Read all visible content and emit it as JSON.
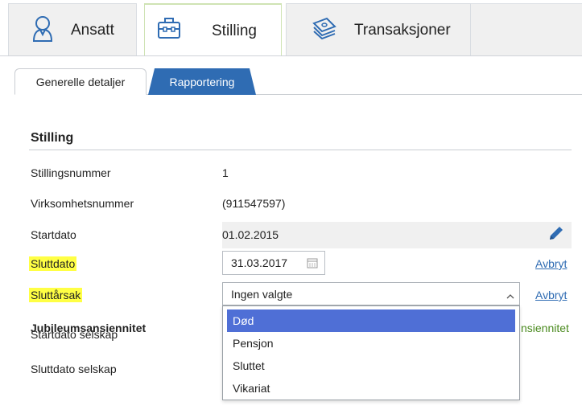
{
  "main_tabs": [
    {
      "label": "Ansatt",
      "icon": "person-icon"
    },
    {
      "label": "Stilling",
      "icon": "briefcase-icon"
    },
    {
      "label": "Transaksjoner",
      "icon": "money-stack-icon"
    }
  ],
  "active_main_tab": "Stilling",
  "sub_tabs": [
    {
      "label": "Generelle detaljer"
    },
    {
      "label": "Rapportering"
    }
  ],
  "section": {
    "title": "Stilling"
  },
  "fields": {
    "stillingsnummer": {
      "label": "Stillingsnummer",
      "value": "1"
    },
    "virksomhetsnummer": {
      "label": "Virksomhetsnummer",
      "value": "(911547597)"
    },
    "startdato": {
      "label": "Startdato",
      "value": "01.02.2015"
    },
    "sluttdato": {
      "label": "Sluttdato",
      "value": "31.03.2017",
      "cancel": "Avbryt"
    },
    "sluttarsak": {
      "label": "Sluttårsak",
      "value": "Ingen valgte",
      "cancel": "Avbryt"
    },
    "jubileum": {
      "label": "Jubileumsansiennitet",
      "peek": "nsiennitet"
    },
    "startdato_selskap": {
      "label": "Startdato selskap"
    },
    "sluttdato_selskap": {
      "label": "Sluttdato selskap"
    }
  },
  "dropdown_options": [
    "Død",
    "Pensjon",
    "Sluttet",
    "Vikariat"
  ],
  "selected_option": "Død",
  "colors": {
    "accent_blue": "#2f6cb3",
    "highlight": "#ffff44",
    "option_selected": "#4f6fd6",
    "active_tab_border": "#cfe3b4"
  }
}
